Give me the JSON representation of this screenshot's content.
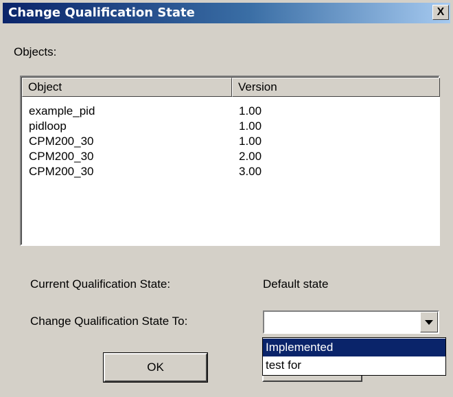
{
  "window": {
    "title": "Change Qualification State",
    "close_glyph": "X"
  },
  "objects_label": "Objects:",
  "list": {
    "columns": [
      "Object",
      "Version"
    ],
    "rows": [
      {
        "object": "example_pid",
        "version": "1.00"
      },
      {
        "object": "pidloop",
        "version": "1.00"
      },
      {
        "object": "CPM200_30",
        "version": "1.00"
      },
      {
        "object": "CPM200_30",
        "version": "2.00"
      },
      {
        "object": "CPM200_30",
        "version": "3.00"
      }
    ]
  },
  "current_state": {
    "label": "Current Qualification State:",
    "value": "Default state"
  },
  "change_to": {
    "label": "Change Qualification State To:",
    "value": "",
    "options": [
      "Implemented",
      "test for"
    ],
    "highlighted_option": "Implemented"
  },
  "buttons": {
    "ok_label": "OK"
  },
  "icons": {
    "close": "close-icon",
    "dropdown": "chevron-down-icon"
  },
  "colors": {
    "titlebar_start": "#0a246a",
    "titlebar_end": "#a6caf0",
    "face": "#d4d0c8",
    "selection": "#0a246a"
  }
}
